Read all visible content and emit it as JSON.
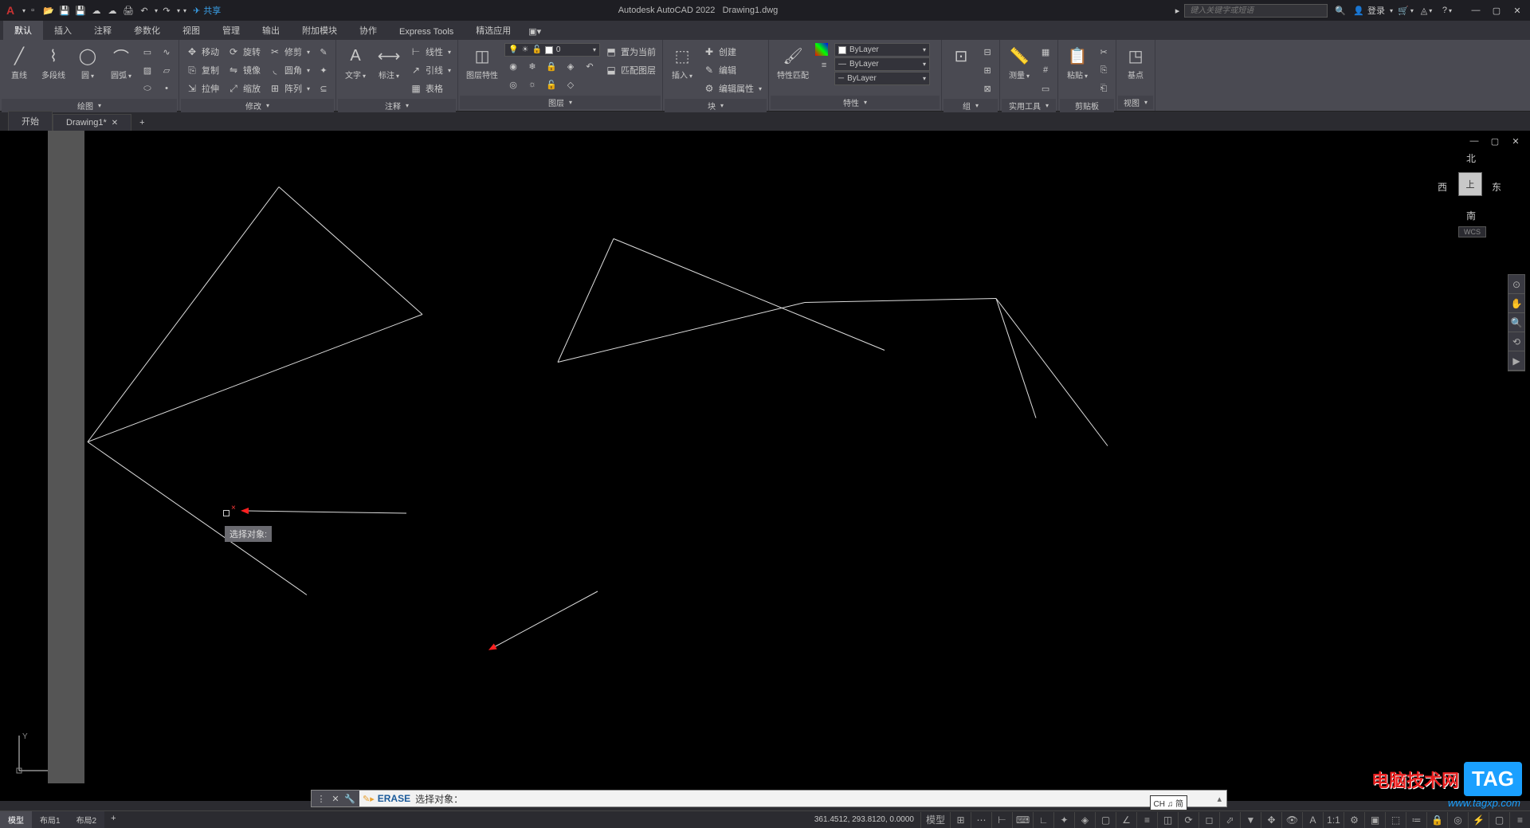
{
  "title": {
    "app": "Autodesk AutoCAD 2022",
    "doc": "Drawing1.dwg"
  },
  "qat_share": "共享",
  "search": {
    "placeholder": "键入关键字或短语"
  },
  "login": "登录",
  "menu": [
    "默认",
    "插入",
    "注释",
    "参数化",
    "视图",
    "管理",
    "输出",
    "附加模块",
    "协作",
    "Express Tools",
    "精选应用"
  ],
  "ribbon": {
    "draw": {
      "label": "绘图",
      "line": "直线",
      "pline": "多段线",
      "circle": "圆",
      "arc": "圆弧"
    },
    "modify": {
      "label": "修改",
      "move": "移动",
      "copy": "复制",
      "stretch": "拉伸",
      "rotate": "旋转",
      "mirror": "镜像",
      "scale": "缩放",
      "trim": "修剪",
      "fillet": "圆角",
      "array": "阵列"
    },
    "annot": {
      "label": "注释",
      "text": "文字",
      "dim": "标注",
      "leader": "引线",
      "table": "表格",
      "linear": "线性"
    },
    "layers": {
      "label": "图层",
      "props": "图层特性",
      "layer_name": "0",
      "setcurrent": "置为当前",
      "match": "匹配图层"
    },
    "block": {
      "label": "块",
      "insert": "插入",
      "create": "创建",
      "edit": "编辑",
      "editattr": "编辑属性"
    },
    "props": {
      "label": "特性",
      "match": "特性匹配",
      "bylayer": "ByLayer"
    },
    "group": {
      "label": "组"
    },
    "utils": {
      "label": "实用工具",
      "measure": "测量"
    },
    "clip": {
      "label": "剪贴板",
      "paste": "粘贴"
    },
    "view": {
      "label": "视图",
      "base": "基点"
    }
  },
  "file_tabs": {
    "start": "开始",
    "drawing": "Drawing1*"
  },
  "navcube": {
    "n": "北",
    "s": "南",
    "e": "东",
    "w": "西",
    "top": "上",
    "wcs": "WCS"
  },
  "cursor_prompt": "选择对象:",
  "cmd": {
    "history": "ERASE",
    "keyword": "ERASE",
    "prompt": "选择对象："
  },
  "ime": "CH ♫ 简",
  "status": {
    "coords": "361.4512, 293.8120, 0.0000",
    "model": "模型",
    "layouts": [
      "模型",
      "布局1",
      "布局2"
    ]
  },
  "watermark": {
    "text": "电脑技术网",
    "tag": "TAG",
    "url": "www.tagxp.com"
  }
}
